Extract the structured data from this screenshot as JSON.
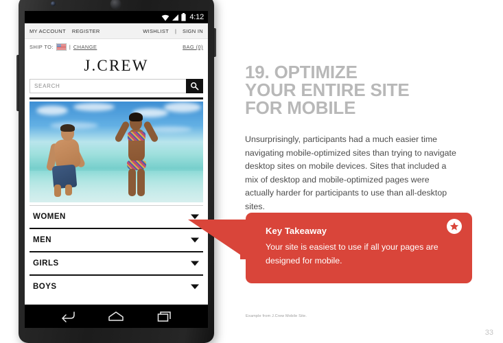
{
  "slide": {
    "page_number": "33",
    "source_caption": "Example from J.Crew Mobile Site.",
    "heading_lines": [
      "19. OPTIMIZE",
      "YOUR ENTIRE SITE",
      "FOR MOBILE"
    ],
    "body_copy": "Unsurprisingly, participants had a much easier time navigating mobile-optimized sites than trying to navigate desktop sites on mobile devices. Sites that included a mix of desktop and mobile-optimized pages were actually harder for participants to use than all-desktop sites.",
    "heading_color": "#b8b8b8",
    "body_color": "#4b4b4b"
  },
  "callout": {
    "title": "Key Takeaway",
    "body": "Your site is easiest to use if all your pages are designed for mobile.",
    "background_color": "#d9453a",
    "star_icon": "star-icon"
  },
  "phone": {
    "status_bar": {
      "time": "4:12",
      "icons": [
        "wifi-icon",
        "signal-icon",
        "battery-icon"
      ]
    },
    "android_nav": {
      "back": "back-icon",
      "home": "home-icon",
      "recents": "recents-icon"
    },
    "site": {
      "utility_bar": {
        "left_links": [
          "MY ACCOUNT",
          "REGISTER"
        ],
        "right_links": [
          "WISHLIST",
          "SIGN IN"
        ],
        "separator": "|"
      },
      "ship_bar": {
        "label": "SHIP TO:",
        "flag": "us-flag-icon",
        "separator": "|",
        "change_link": "CHANGE",
        "bag_link": "BAG (0)"
      },
      "logo": "J.CREW",
      "search": {
        "placeholder": "SEARCH",
        "value": "",
        "button_icon": "search-icon"
      },
      "hero_alt": "beach-photo",
      "nav_items": [
        {
          "label": "WOMEN",
          "caret": "chevron-down-icon"
        },
        {
          "label": "MEN",
          "caret": "chevron-down-icon"
        },
        {
          "label": "GIRLS",
          "caret": "chevron-down-icon"
        },
        {
          "label": "BOYS",
          "caret": "chevron-down-icon"
        }
      ]
    }
  }
}
